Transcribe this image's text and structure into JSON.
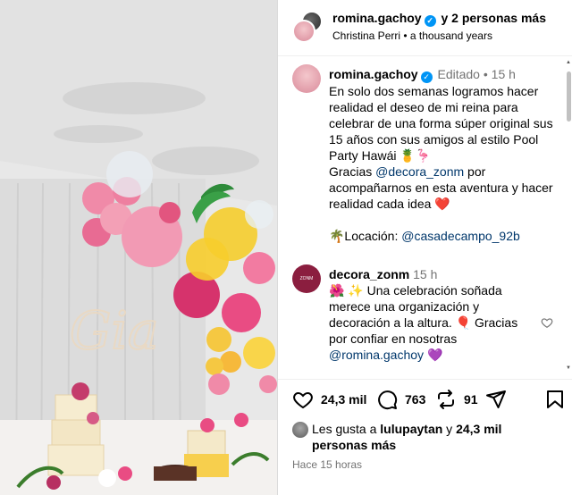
{
  "header": {
    "username": "romina.gachoy",
    "collab_text": "y 2 personas más",
    "audio": "Christina Perri • a thousand years"
  },
  "caption": {
    "username": "romina.gachoy",
    "status": "Editado",
    "time": "15 h",
    "text_lines": [
      "En solo dos semanas logramos hacer realidad el deseo de mi reina para celebrar de una forma súper original sus 15 años con sus amigos al estilo Pool Party Hawái 🍍🦩",
      "Gracias ",
      " por acompañarnos en esta aventura y hacer realidad cada idea ❤️"
    ],
    "mention": "@decora_zonm",
    "location_label": "🌴Locación: ",
    "location_handle": "@casadecampo_92b"
  },
  "comment": {
    "username": "decora_zonm",
    "time": "15 h",
    "text": "🌺 ✨ Una celebración soñada merece una organización y decoración a la altura. 🎈 Gracias por confiar en nosotras ",
    "mention": "@romina.gachoy",
    "end_emoji": "💜",
    "avatar_text": "ZONM"
  },
  "actions": {
    "like_count": "24,3 mil",
    "comment_count": "763",
    "repost_count": "91"
  },
  "likes": {
    "prefix": "Les gusta a ",
    "user": "lulupaytan",
    "middle": " y ",
    "rest": "24,3 mil personas más"
  },
  "timestamp": "Hace 15 horas",
  "photo": {
    "sign_text": "Gia"
  },
  "colors": {
    "link": "#00376b",
    "verified": "#0095f6",
    "muted": "#737373"
  }
}
